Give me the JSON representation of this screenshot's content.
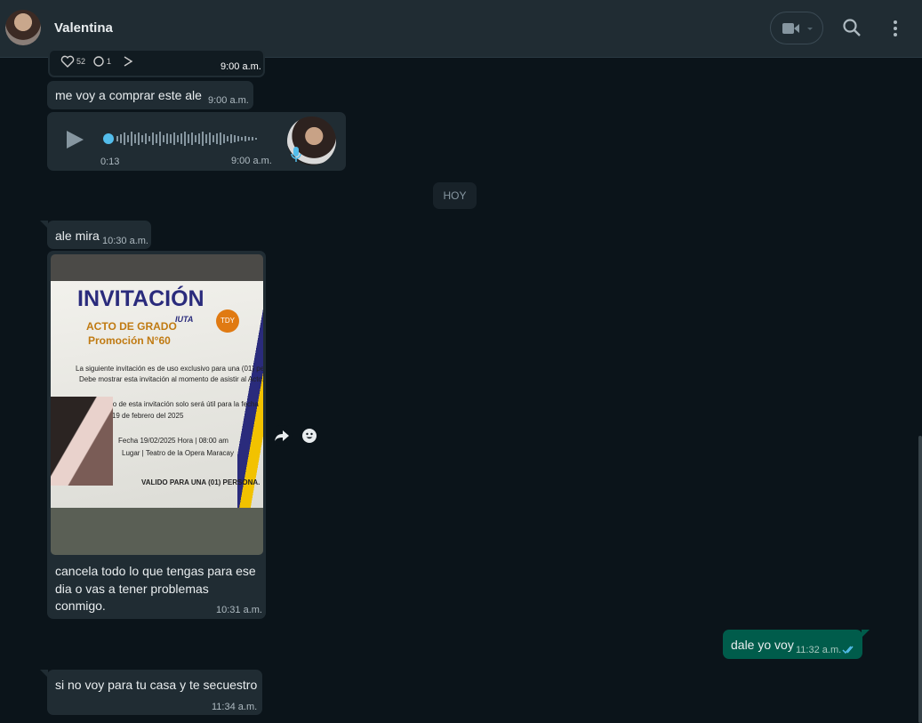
{
  "header": {
    "contact_name": "Valentina",
    "icons": [
      "video-icon",
      "search-icon",
      "menu-icon"
    ]
  },
  "messages": {
    "prev_post_time": "9:00 a.m.",
    "prev_post_likes": "52",
    "prev_post_comments": "1",
    "msg1_text": "me voy a comprar este ale",
    "msg1_time": "9:00 a.m.",
    "voice_duration": "0:13",
    "voice_time": "9:00 a.m.",
    "date_chip": "HOY",
    "msg2_text": "ale mira",
    "msg2_time": "10:30 a.m.",
    "image_caption_line1": "cancela todo lo que tengas para ese",
    "image_caption_line2": "dia o vas a tener problemas",
    "image_caption_line3": "conmigo.",
    "image_time": "10:31 a.m.",
    "out_text": "dale yo voy",
    "out_time": "11:32 a.m.",
    "msg3_text": "si no voy para tu casa y te secuestro",
    "msg3_time": "11:34 a.m."
  },
  "invitation": {
    "title": "INVITACIÓN",
    "sub1": "ACTO DE GRADO",
    "sub2": "Promoción N°60",
    "line1": "La siguiente invitación es de uso exclusivo para una (01) pers",
    "line2": "Debe mostrar esta invitación al momento de asistir al Acto.",
    "line3": "El uso de esta invitación solo será útil para la fecha",
    "line4": "del 19 de febrero del 2025",
    "line5": "Fecha 19/02/2025 Hora | 08:00 am",
    "line6": "Lugar | Teatro de la Opera Maracay",
    "valid": "VALIDO PARA UNA (01) PERSONA.",
    "logo1": "IUTA",
    "logo2": "TDY"
  },
  "colors": {
    "header_bg": "#202c33",
    "chat_bg": "#0b141a",
    "bubble_in": "#202c33",
    "bubble_out": "#005c4b",
    "read_ticks": "#53bdeb",
    "voice_dot": "#53bdeb"
  }
}
